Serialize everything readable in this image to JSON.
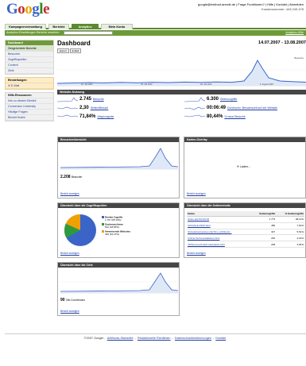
{
  "header": {
    "account_line": "google@hellmut.arendt.de | Frage Funktionen? | Hilfe | Kontakt | Abmelden",
    "account_sub": "Kundennummer: 443.249.478"
  },
  "tabs": [
    {
      "label": "Kampagnenverwaltung",
      "active": false
    },
    {
      "label": "Berichte",
      "active": false
    },
    {
      "label": "Analytics",
      "active": true
    },
    {
      "label": "Mein Konto",
      "active": false
    }
  ],
  "subbar": {
    "left": "Analytics-Einstellungen  Berichte ansehen:",
    "select": "",
    "right": "Analytics-Hilfe"
  },
  "sidebar": {
    "nav": [
      {
        "label": "Dashboard",
        "style": "head"
      },
      {
        "label": "Zielgerichtete Berichte",
        "style": "pale"
      },
      {
        "label": "Besucher",
        "style": ""
      },
      {
        "label": "Zugriffsquellen",
        "style": ""
      },
      {
        "label": "Content",
        "style": ""
      },
      {
        "label": "Ziele",
        "style": ""
      }
    ],
    "settings_title": "Einstellungen",
    "settings_items": [
      "E-Mail"
    ],
    "resources_title": "Hilfe-Ressourcen",
    "resources": [
      "Info zu diesem Bericht",
      "Conversion University",
      "Häufige Fragen",
      "Bericht finden"
    ]
  },
  "main": {
    "title": "Dashboard",
    "date_range": "14.07.2007 - 13.08.2007",
    "export": "Export",
    "email": "E-Mail",
    "chart_legend": "Besuche",
    "chart_axis_labels": [
      "16. Juli 2007",
      "23. Juli 2007",
      "30. Juli 2007",
      "6. August 2007"
    ]
  },
  "usage": {
    "title": "Website-Nutzung",
    "stats": [
      {
        "value": "2.745",
        "label": "Besuche"
      },
      {
        "value": "2,30",
        "label": "Seiten/Besuch"
      },
      {
        "value": "71,84%",
        "label": "Absprungrate"
      },
      {
        "value": "6.300",
        "label": "Seitenzugriffe"
      },
      {
        "value": "00:06:49",
        "label": "Durchschn. Besuchszeit auf der Website"
      },
      {
        "value": "80,44%",
        "label": "% neue Besuche"
      }
    ]
  },
  "panels": {
    "visitors": {
      "title": "Besucherübersicht",
      "total": "2.208",
      "total_label": "Besucher",
      "report": "Bericht anzeigen"
    },
    "map": {
      "title": "Karten-Overlay",
      "loading": "Laden...",
      "report": "Bericht anzeigen"
    },
    "sources": {
      "title": "Übersicht über die Zugriffsquellen",
      "items": [
        {
          "label": "Direkte Zugriffe",
          "detail": "1.797 (65,79%)",
          "color": "#3a64c8"
        },
        {
          "label": "Suchmaschinen",
          "detail": "512 (18,65%)",
          "color": "#2e9a3c"
        },
        {
          "label": "Verweisende Websites",
          "detail": "425 (15,47%)",
          "color": "#f0a000"
        }
      ],
      "report": "Bericht anzeigen"
    },
    "content": {
      "title": "Übersicht über die Seiteninhalte",
      "columns": [
        "Seiten",
        "Seitenzugriffe",
        "% Seitenzugriffe"
      ],
      "rows": [
        {
          "page": "/index.php?id=34.62",
          "views": "1.773",
          "pct": "28,14%"
        },
        {
          "page": "/GOOGLE-TEST.html",
          "views": "480",
          "pct": "7,62%"
        },
        {
          "page": "/include/sw/nanotec.php?lnm_id=Dienst...",
          "views": "347",
          "pct": "5,51%"
        },
        {
          "page": "/(=fix)s-Tech-kontaktieren.html",
          "views": "262",
          "pct": "4,16%"
        },
        {
          "page": "/IS/Success/Coach-Newsletter.html",
          "views": "248",
          "pct": "3,94%"
        }
      ],
      "report": "Bericht anzeigen"
    },
    "goals": {
      "title": "Übersicht über die Ziele",
      "total": "90",
      "total_label": "Ziel-Conversions",
      "report": "Bericht anzeigen"
    }
  },
  "footer": {
    "copyright": "©2007 Google",
    "links": [
      "AdWords-Startseite",
      "Redaktionelle Richtlinien",
      "Datenschutzbestimmungen",
      "Kontakt"
    ]
  },
  "colors": {
    "accent": "#6c9b37",
    "dark_head": "#464646",
    "line": "#3a64c8"
  }
}
